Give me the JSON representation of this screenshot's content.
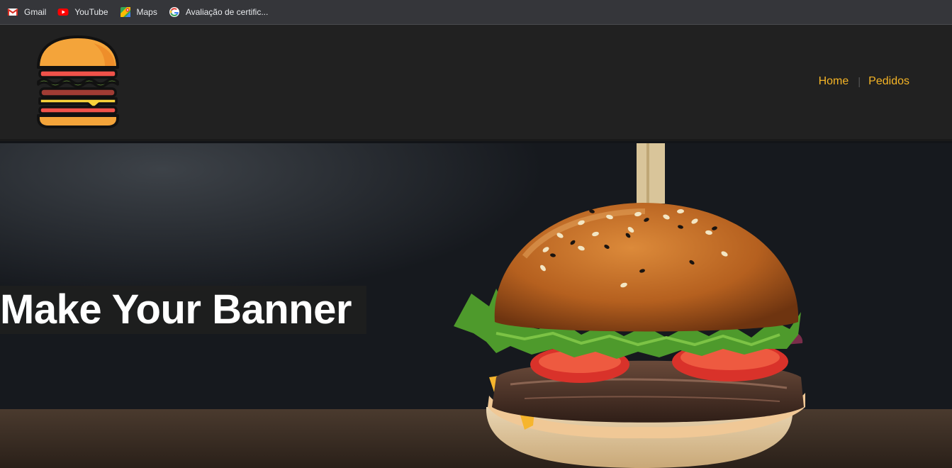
{
  "bookmarks": [
    {
      "label": "Gmail",
      "icon": "gmail-icon"
    },
    {
      "label": "YouTube",
      "icon": "youtube-icon"
    },
    {
      "label": "Maps",
      "icon": "maps-icon"
    },
    {
      "label": "Avaliação de certific...",
      "icon": "google-icon"
    }
  ],
  "header": {
    "logo": "burger-logo-icon",
    "nav": {
      "home": "Home",
      "separator": "|",
      "orders": "Pedidos"
    }
  },
  "banner": {
    "title": "Make Your Banner",
    "image": "burger-photo"
  },
  "colors": {
    "nav_link": "#f6b526",
    "header_bg": "#212121",
    "bookmarks_bg": "#35363a"
  }
}
